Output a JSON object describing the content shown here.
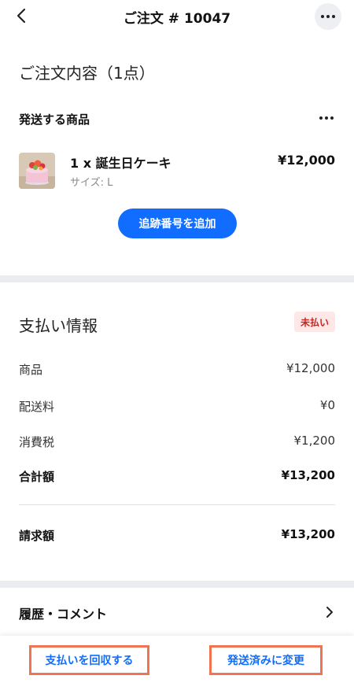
{
  "header": {
    "title": "ご注文 # 10047",
    "back_icon": "chevron-left-icon",
    "more_icon": "more-horizontal-icon"
  },
  "order_contents": {
    "title": "ご注文内容（1点）",
    "shipment_label": "発送する商品",
    "item": {
      "quantity_name": "1 x 誕生日ケーキ",
      "variant": "サイズ: L",
      "price": "¥12,000",
      "thumbnail": "cake-thumbnail"
    },
    "add_tracking_label": "追跡番号を追加"
  },
  "payment": {
    "title": "支払い情報",
    "status_badge": "未払い",
    "rows": [
      {
        "label": "商品",
        "value": "¥12,000"
      },
      {
        "label": "配送料",
        "value": "¥0"
      },
      {
        "label": "消費税",
        "value": "¥1,200"
      },
      {
        "label": "合計額",
        "value": "¥13,200"
      }
    ],
    "billed": {
      "label": "請求額",
      "value": "¥13,200"
    }
  },
  "history": {
    "label": "履歴・コメント"
  },
  "actions": {
    "collect_payment": "支払いを回収する",
    "mark_shipped": "発送済みに変更"
  },
  "colors": {
    "primary": "#116dff",
    "unpaid_badge_bg": "#fde7e7",
    "unpaid_badge_text": "#c8251f",
    "highlight_border": "#ef7552",
    "divider": "#ebecf0"
  }
}
